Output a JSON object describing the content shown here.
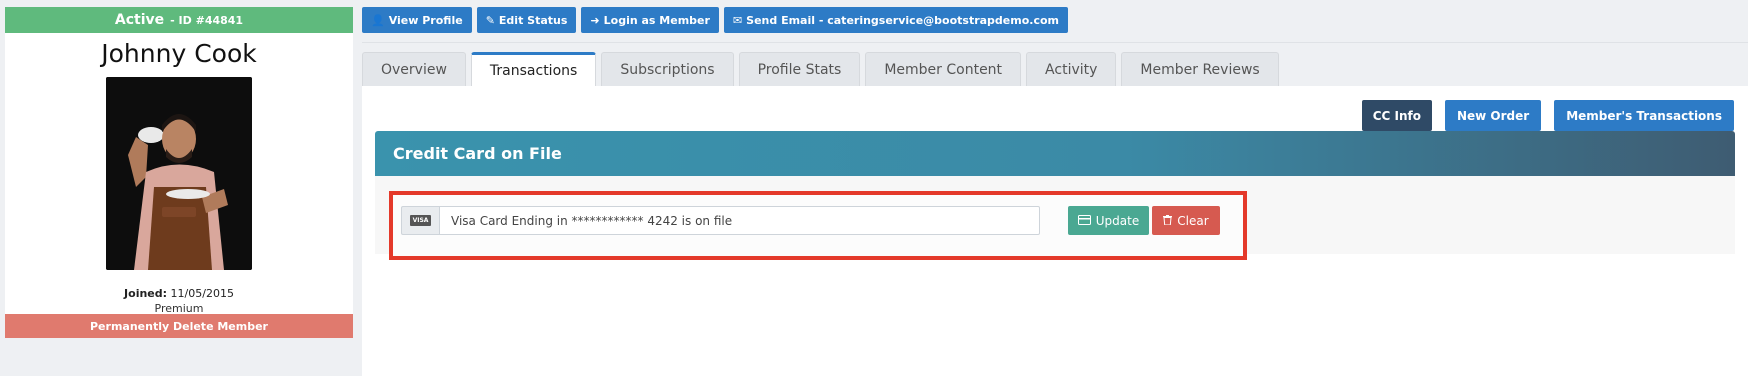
{
  "profile": {
    "status": "Active",
    "id_label": "- ID #44841",
    "name": "Johnny Cook",
    "joined_label": "Joined:",
    "joined_date": "11/05/2015",
    "plan": "Premium",
    "delete_label": "Permanently Delete Member"
  },
  "actions": {
    "view_profile": "View Profile",
    "edit_status": "Edit Status",
    "login_as_member": "Login as Member",
    "send_email": "Send Email - cateringservice@bootstrapdemo.com"
  },
  "tabs": [
    {
      "label": "Overview"
    },
    {
      "label": "Transactions"
    },
    {
      "label": "Subscriptions"
    },
    {
      "label": "Profile Stats"
    },
    {
      "label": "Member Content"
    },
    {
      "label": "Activity"
    },
    {
      "label": "Member Reviews"
    }
  ],
  "active_tab": "Transactions",
  "toolbar": {
    "cc_info": "CC Info",
    "new_order": "New Order",
    "members_transactions": "Member's Transactions"
  },
  "credit_card": {
    "header": "Credit Card on File",
    "badge": "VISA",
    "value": "Visa Card Ending in ************ 4242 is on file",
    "update_label": "Update",
    "clear_label": "Clear"
  },
  "colors": {
    "status_green": "#5fba7d",
    "primary_blue": "#2d7bc6",
    "danger_red": "#d65a50",
    "highlight_frame": "#e4392a",
    "success_teal": "#4aa892"
  }
}
